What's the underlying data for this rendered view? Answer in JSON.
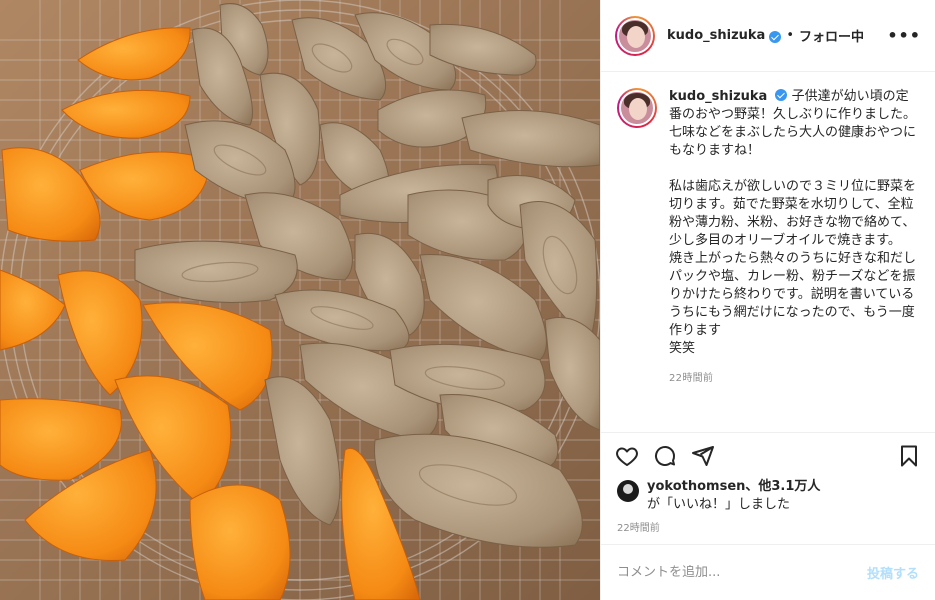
{
  "post": {
    "image_alt": "",
    "header": {
      "username": "kudo_shizuka",
      "separator": "•",
      "follow_label": "フォロー中",
      "more_label": "•••"
    },
    "caption": {
      "username": "kudo_shizuka",
      "text": "子供達が幼い頃の定番のおやつ野菜！久しぶりに作りました。七味などをまぶしたら大人の健康おやつにもなりますね！\n\n私は歯応えが欲しいので３ミリ位に野菜を切ります。茹でた野菜を水切りして、全粒粉や薄力粉、米粉、お好きな物で絡めて、少し多目のオリーブオイルで焼きます。\n焼き上がったら熱々のうちに好きな和だしパックや塩、カレー粉、粉チーズなどを振りかけたら終わりです。説明を書いているうちにもう網だけになったので、もう一度作ります\n笑笑",
      "time": "22時間前"
    },
    "actions": {
      "like_icon": "heart-outline",
      "comment_icon": "speech-bubble",
      "share_icon": "paper-plane",
      "save_icon": "bookmark-outline"
    },
    "likes": {
      "user": "yokothomsen",
      "others": "、他3.1万人",
      "suffix": "が「いいね！」しました"
    },
    "time": "22時間前",
    "comment": {
      "placeholder": "コメントを追加...",
      "post_label": "投稿する"
    }
  },
  "colors": {
    "verified": "#3897f0",
    "post_button_disabled": "#b2dffc",
    "muted_text": "#8e8e8e",
    "divider": "#efefef"
  }
}
